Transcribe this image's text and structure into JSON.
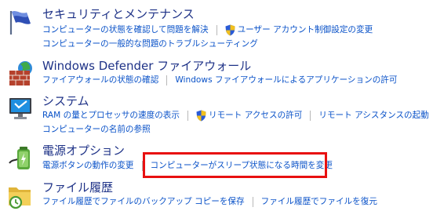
{
  "sections": [
    {
      "title": "セキュリティとメンテナンス",
      "icon": "flag-icon",
      "rows": [
        [
          {
            "label": "コンピューターの状態を確認して問題を解決",
            "shield": false
          },
          {
            "label": "ユーザー アカウント制御設定の変更",
            "shield": true
          }
        ],
        [
          {
            "label": "コンピューターの一般的な問題のトラブルシューティング",
            "shield": false
          }
        ]
      ]
    },
    {
      "title": "Windows Defender ファイアウォール",
      "icon": "firewall-icon",
      "rows": [
        [
          {
            "label": "ファイアウォールの状態の確認",
            "shield": false
          },
          {
            "label": "Windows ファイアウォールによるアプリケーションの許可",
            "shield": false
          }
        ]
      ]
    },
    {
      "title": "システム",
      "icon": "computer-monitor-icon",
      "rows": [
        [
          {
            "label": "RAM の量とプロセッサの速度の表示",
            "shield": false
          },
          {
            "label": "リモート アクセスの許可",
            "shield": true
          },
          {
            "label": "リモート アシスタンスの起動",
            "shield": false
          }
        ],
        [
          {
            "label": "コンピューターの名前の参照",
            "shield": false
          }
        ]
      ]
    },
    {
      "title": "電源オプション",
      "icon": "power-battery-icon",
      "rows": [
        [
          {
            "label": "電源ボタンの動作の変更",
            "shield": false
          },
          {
            "label": "コンピューターがスリープ状態になる時間を変更",
            "shield": false
          }
        ]
      ]
    },
    {
      "title": "ファイル履歴",
      "icon": "file-history-icon",
      "rows": [
        [
          {
            "label": "ファイル履歴でファイルのバックアップ コピーを保存",
            "shield": false
          },
          {
            "label": "ファイル履歴でファイルを復元",
            "shield": false
          }
        ]
      ]
    }
  ],
  "colors": {
    "title": "#1e3287",
    "link": "#0a52c8",
    "highlight": "#e81010"
  }
}
